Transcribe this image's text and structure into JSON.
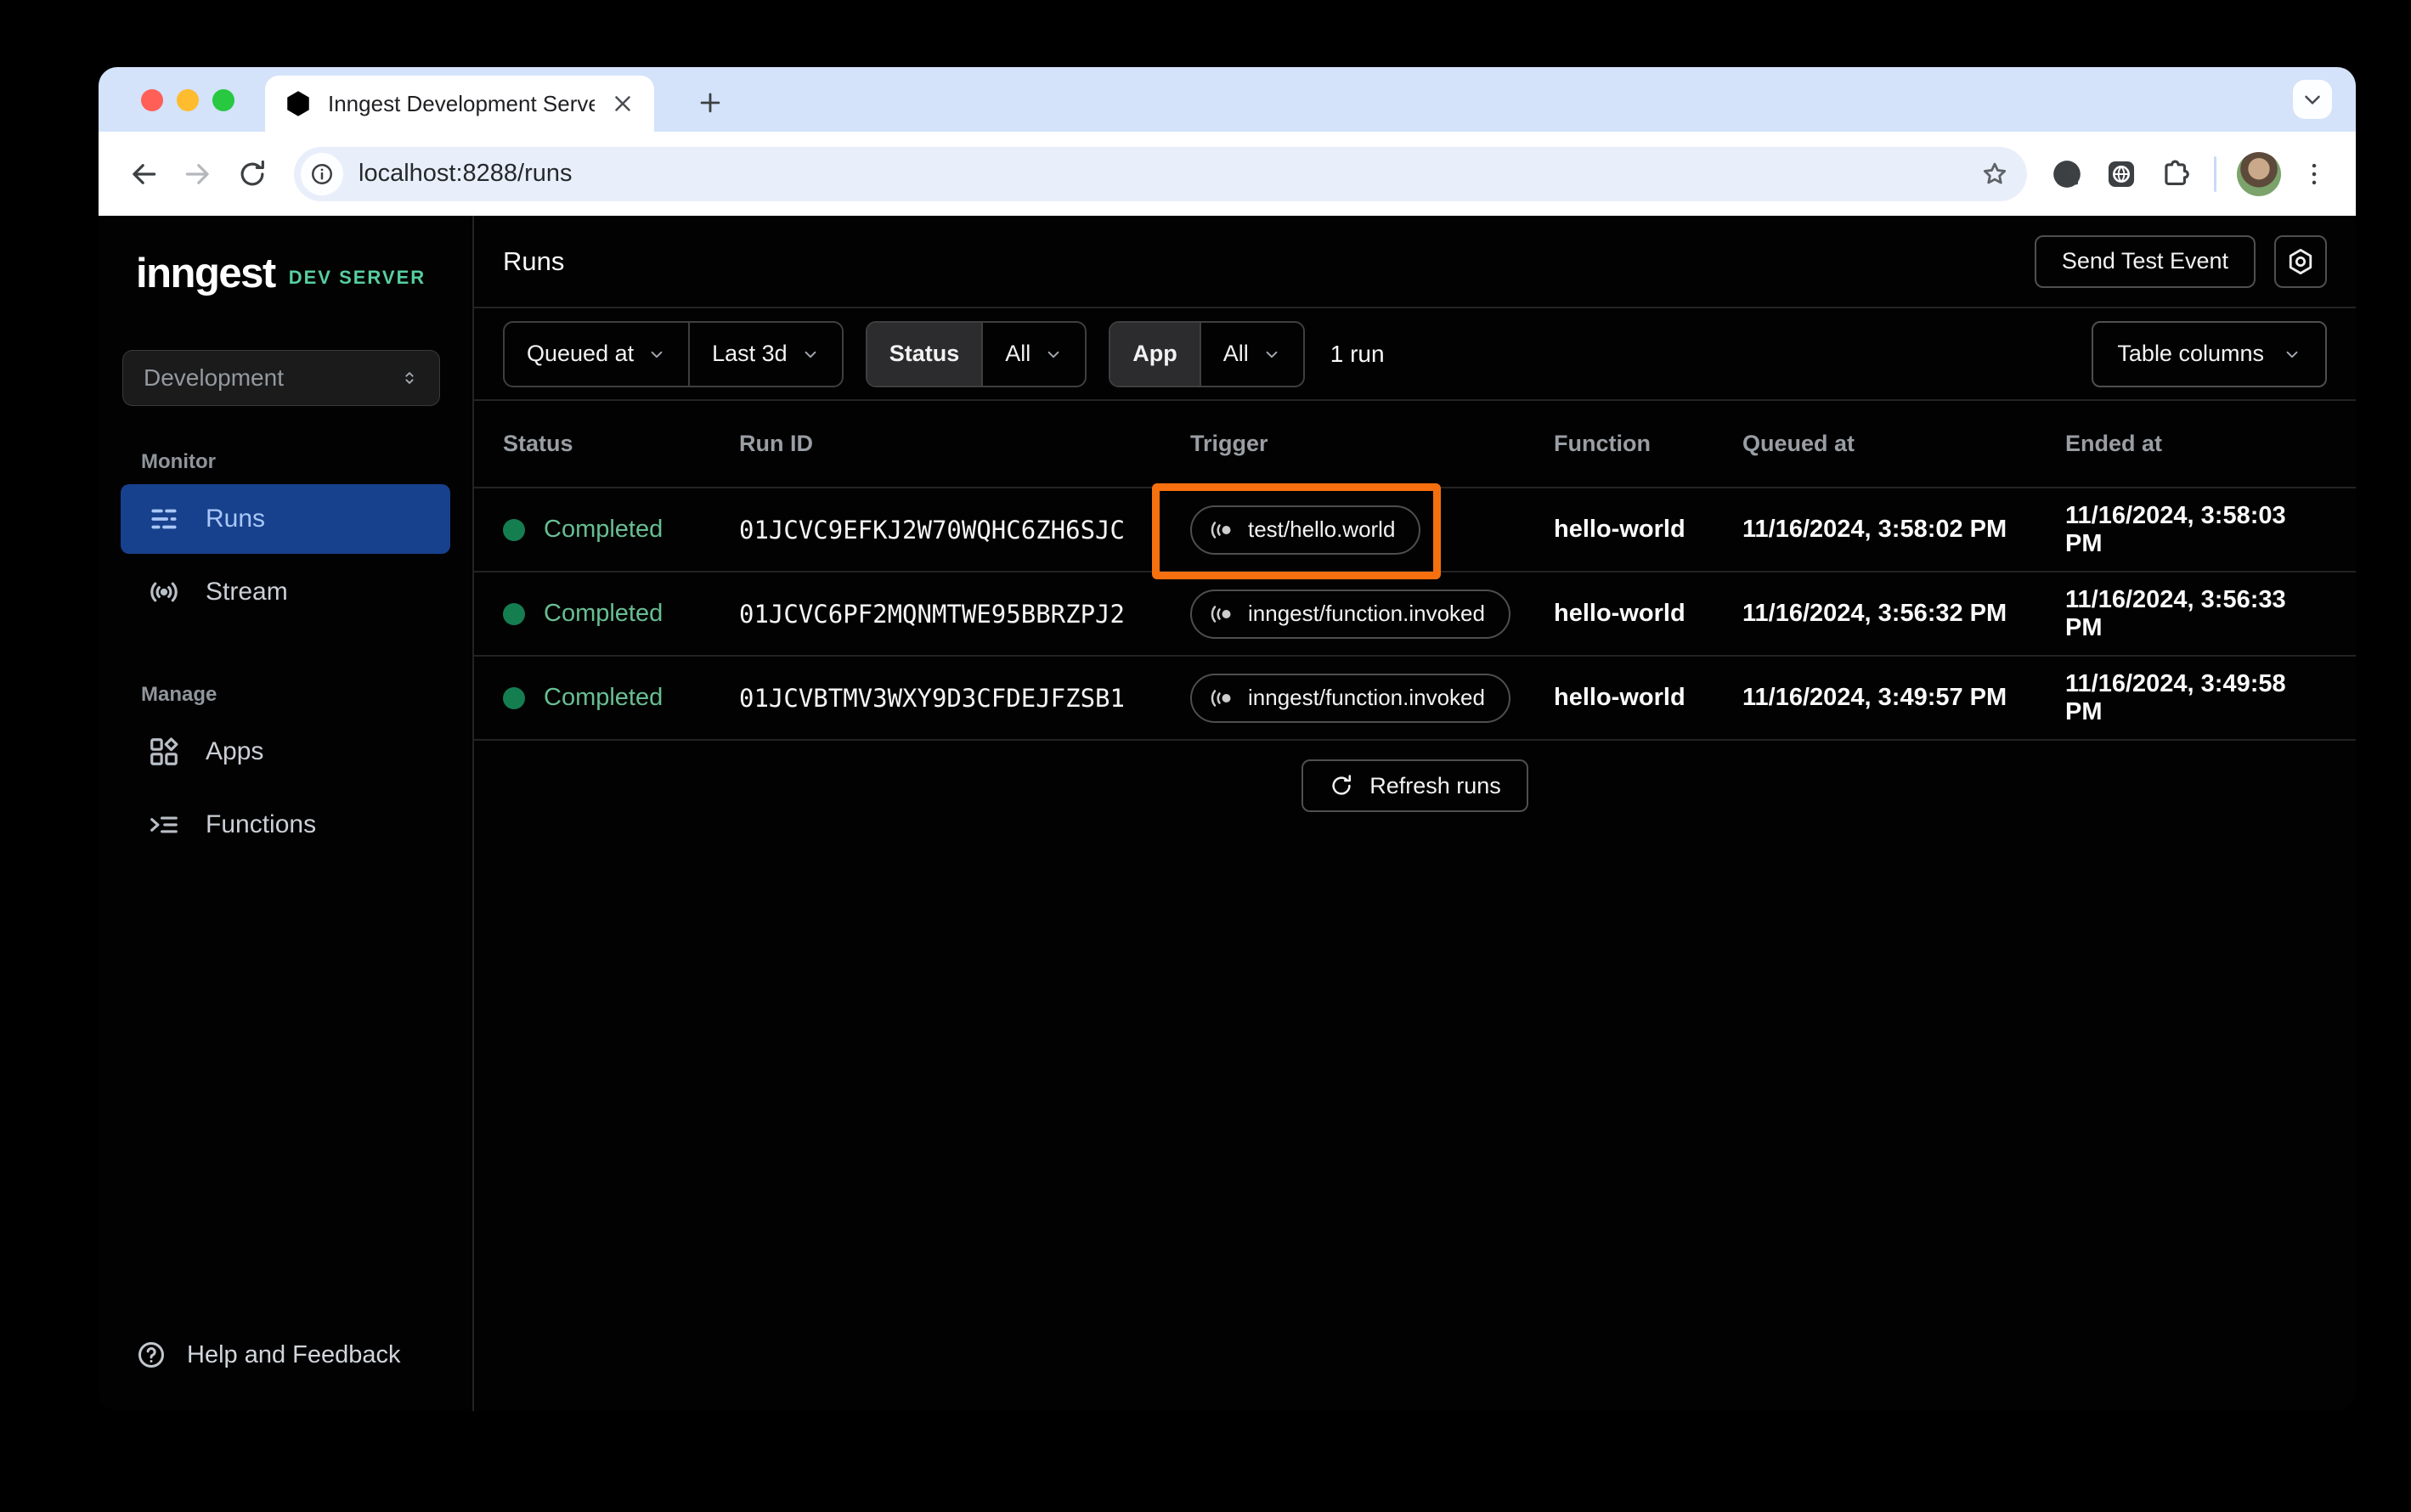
{
  "colors": {
    "highlight_orange": "#F7700F",
    "active_nav_blue": "#17418C",
    "status_green_text": "#68BE92",
    "status_green_dot": "#157E50",
    "brand_green": "#57CFA0",
    "tabstrip_blue": "#D4E2FA"
  },
  "browser": {
    "tab_title": "Inngest Development Server",
    "url": "localhost:8288/runs"
  },
  "sidebar": {
    "logo": "inngest",
    "badge": "DEV SERVER",
    "environment": "Development",
    "monitor_label": "Monitor",
    "manage_label": "Manage",
    "items": {
      "runs": "Runs",
      "stream": "Stream",
      "apps": "Apps",
      "functions": "Functions"
    },
    "help": "Help and Feedback"
  },
  "header": {
    "title": "Runs",
    "send_test_event": "Send Test Event"
  },
  "filters": {
    "field": "Queued at",
    "range": "Last 3d",
    "status_label": "Status",
    "status_value": "All",
    "app_label": "App",
    "app_value": "All",
    "count": "1 run",
    "table_columns": "Table columns"
  },
  "table": {
    "headers": {
      "status": "Status",
      "run_id": "Run ID",
      "trigger": "Trigger",
      "function": "Function",
      "queued_at": "Queued at",
      "ended_at": "Ended at"
    },
    "rows": [
      {
        "status": "Completed",
        "run_id": "01JCVC9EFKJ2W70WQHC6ZH6SJC",
        "trigger": "test/hello.world",
        "function": "hello-world",
        "queued_at": "11/16/2024, 3:58:02 PM",
        "ended_at": "11/16/2024, 3:58:03 PM"
      },
      {
        "status": "Completed",
        "run_id": "01JCVC6PF2MQNMTWE95BBRZPJ2",
        "trigger": "inngest/function.invoked",
        "function": "hello-world",
        "queued_at": "11/16/2024, 3:56:32 PM",
        "ended_at": "11/16/2024, 3:56:33 PM"
      },
      {
        "status": "Completed",
        "run_id": "01JCVBTMV3WXY9D3CFDEJFZSB1",
        "trigger": "inngest/function.invoked",
        "function": "hello-world",
        "queued_at": "11/16/2024, 3:49:57 PM",
        "ended_at": "11/16/2024, 3:49:58 PM"
      }
    ],
    "refresh": "Refresh runs"
  }
}
